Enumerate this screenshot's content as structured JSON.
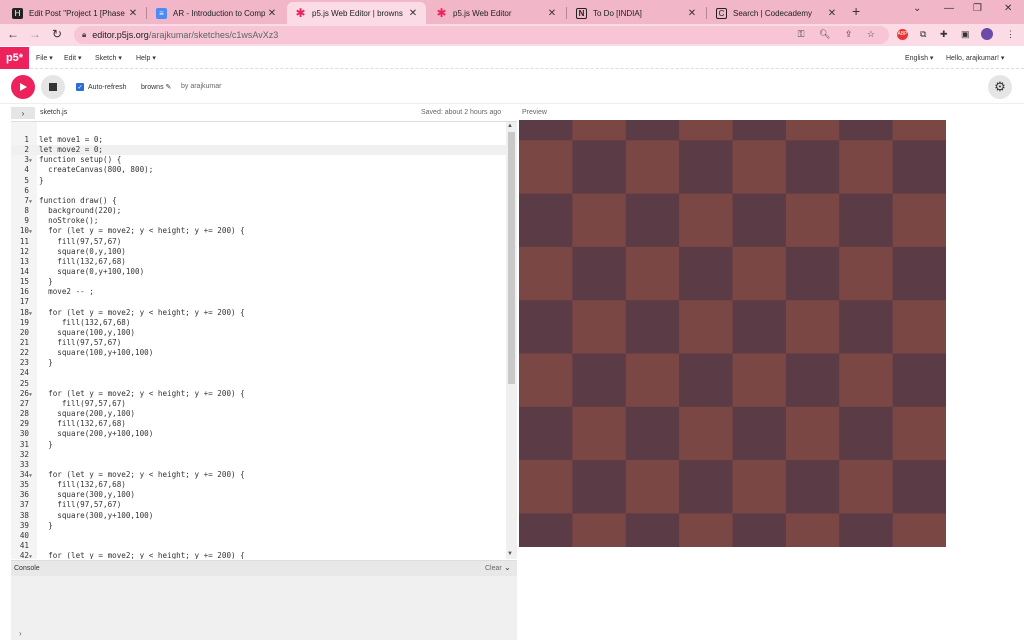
{
  "browser": {
    "tabs": [
      {
        "label": "Edit Post \"Project 1 [Phase",
        "icon": "edit-icon",
        "active": false
      },
      {
        "label": "AR - Introduction to Comp",
        "icon": "doc-icon",
        "active": false
      },
      {
        "label": "p5.js Web Editor | browns",
        "icon": "p5-asterisk-icon",
        "active": true
      },
      {
        "label": "p5.js Web Editor",
        "icon": "p5-asterisk-icon",
        "active": false
      },
      {
        "label": "To Do [INDIA]",
        "icon": "notion-icon",
        "active": false
      },
      {
        "label": "Search | Codecademy",
        "icon": "codecademy-icon",
        "active": false
      }
    ],
    "new_tab": "+",
    "url_host": "editor.p5js.org",
    "url_path": "/arajkumar/sketches/c1wsAvXz3"
  },
  "p5": {
    "logo": "p5*",
    "menu": [
      "File ▾",
      "Edit ▾",
      "Sketch ▾",
      "Help ▾"
    ],
    "language": "English ▾",
    "greeting": "Hello, arajkumar! ▾",
    "auto_refresh": "Auto-refresh",
    "sketch_name": "browns ✎",
    "byline": "by arajkumar",
    "file": "sketch.js",
    "saved": "Saved: about 2 hours ago",
    "preview": "Preview",
    "console": "Console",
    "clear": "Clear",
    "prompt": "›"
  },
  "code": [
    {
      "n": "1",
      "fold": "",
      "text": "let move1 = 0;"
    },
    {
      "n": "2",
      "fold": "",
      "text": "let move2 = 0;"
    },
    {
      "n": "3",
      "fold": "▼",
      "text": "function setup() {"
    },
    {
      "n": "4",
      "fold": "",
      "text": "  createCanvas(800, 800);"
    },
    {
      "n": "5",
      "fold": "",
      "text": "}"
    },
    {
      "n": "6",
      "fold": "",
      "text": ""
    },
    {
      "n": "7",
      "fold": "▼",
      "text": "function draw() {"
    },
    {
      "n": "8",
      "fold": "",
      "text": "  background(220);"
    },
    {
      "n": "9",
      "fold": "",
      "text": "  noStroke();"
    },
    {
      "n": "10",
      "fold": "▼",
      "text": "  for (let y = move2; y < height; y += 200) {"
    },
    {
      "n": "11",
      "fold": "",
      "text": "    fill(97,57,67)"
    },
    {
      "n": "12",
      "fold": "",
      "text": "    square(0,y,100)"
    },
    {
      "n": "13",
      "fold": "",
      "text": "    fill(132,67,68)"
    },
    {
      "n": "14",
      "fold": "",
      "text": "    square(0,y+100,100)"
    },
    {
      "n": "15",
      "fold": "",
      "text": "  }"
    },
    {
      "n": "16",
      "fold": "",
      "text": "  move2 -- ;"
    },
    {
      "n": "17",
      "fold": "",
      "text": ""
    },
    {
      "n": "18",
      "fold": "▼",
      "text": "  for (let y = move2; y < height; y += 200) {"
    },
    {
      "n": "19",
      "fold": "",
      "text": "     fill(132,67,68)"
    },
    {
      "n": "20",
      "fold": "",
      "text": "    square(100,y,100)"
    },
    {
      "n": "21",
      "fold": "",
      "text": "    fill(97,57,67)"
    },
    {
      "n": "22",
      "fold": "",
      "text": "    square(100,y+100,100)"
    },
    {
      "n": "23",
      "fold": "",
      "text": "  }"
    },
    {
      "n": "24",
      "fold": "",
      "text": ""
    },
    {
      "n": "25",
      "fold": "",
      "text": ""
    },
    {
      "n": "26",
      "fold": "▼",
      "text": "  for (let y = move2; y < height; y += 200) {"
    },
    {
      "n": "27",
      "fold": "",
      "text": "     fill(97,57,67)"
    },
    {
      "n": "28",
      "fold": "",
      "text": "    square(200,y,100)"
    },
    {
      "n": "29",
      "fold": "",
      "text": "    fill(132,67,68)"
    },
    {
      "n": "30",
      "fold": "",
      "text": "    square(200,y+100,100)"
    },
    {
      "n": "31",
      "fold": "",
      "text": "  }"
    },
    {
      "n": "32",
      "fold": "",
      "text": ""
    },
    {
      "n": "33",
      "fold": "",
      "text": ""
    },
    {
      "n": "34",
      "fold": "▼",
      "text": "  for (let y = move2; y < height; y += 200) {"
    },
    {
      "n": "35",
      "fold": "",
      "text": "    fill(132,67,68)"
    },
    {
      "n": "36",
      "fold": "",
      "text": "    square(300,y,100)"
    },
    {
      "n": "37",
      "fold": "",
      "text": "    fill(97,57,67)"
    },
    {
      "n": "38",
      "fold": "",
      "text": "    square(300,y+100,100)"
    },
    {
      "n": "39",
      "fold": "",
      "text": "  }"
    },
    {
      "n": "40",
      "fold": "",
      "text": ""
    },
    {
      "n": "41",
      "fold": "",
      "text": ""
    },
    {
      "n": "42",
      "fold": "▼",
      "text": "  for (let y = move2; y < height; y += 200) {"
    }
  ],
  "colors": {
    "p5_pink": "#ed225d",
    "dark_brown": "#5b3b45",
    "light_brown": "#7b4744",
    "tab_strip": "#f2b6c9"
  },
  "canvas_pattern": {
    "cols": 8,
    "rows": 9,
    "first_row_partial": true,
    "colors": [
      "#5b3b45",
      "#7b4744"
    ]
  }
}
